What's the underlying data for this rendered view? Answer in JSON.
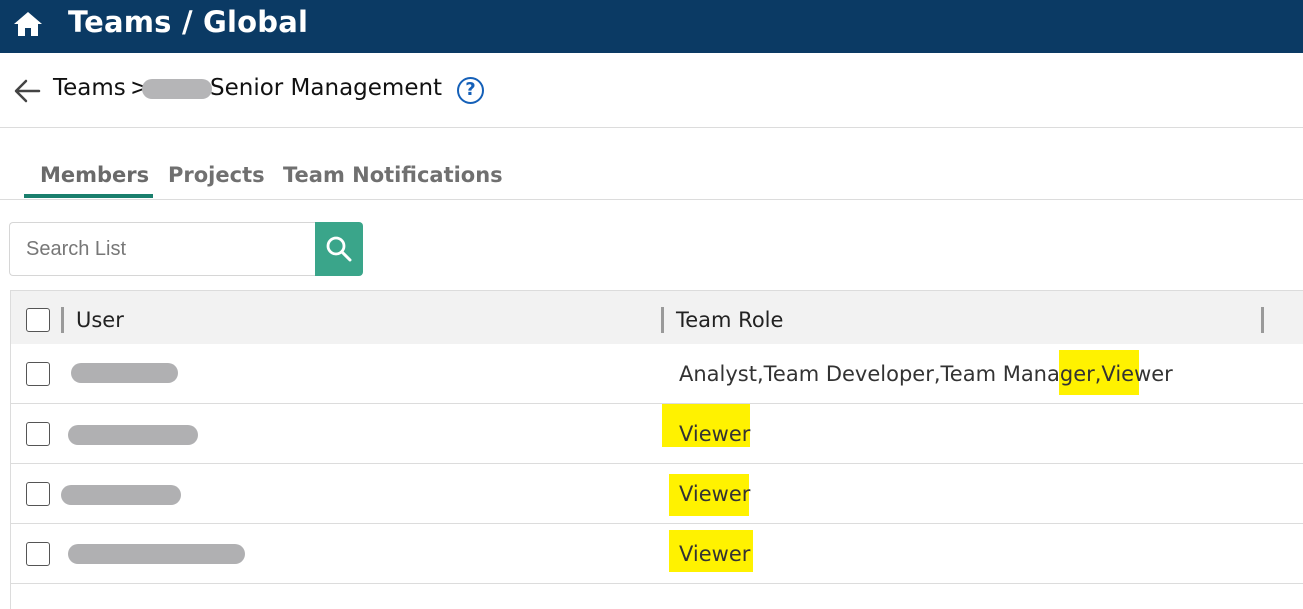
{
  "topbar": {
    "title": "Teams / Global",
    "icon": "home-icon"
  },
  "breadcrumb": {
    "teams": "Teams",
    "separator": ">",
    "current": "Senior Management",
    "help": "?"
  },
  "tabs": [
    {
      "label": "Members",
      "active": true
    },
    {
      "label": "Projects",
      "active": false
    },
    {
      "label": "Team Notifications",
      "active": false
    }
  ],
  "search": {
    "placeholder": "Search List"
  },
  "table": {
    "headers": {
      "user": "User",
      "team_role": "Team Role"
    },
    "rows": [
      {
        "role_prefix": "Analyst,Team Developer,Team Manager,",
        "role_highlight": "Viewer"
      },
      {
        "role_prefix": "",
        "role_highlight": "Viewer"
      },
      {
        "role_prefix": "",
        "role_highlight": "Viewer"
      },
      {
        "role_prefix": "",
        "role_highlight": "Viewer"
      }
    ]
  },
  "colors": {
    "topbar": "#0b3a64",
    "accent": "#1a7f6d",
    "search_button": "#3aa58a",
    "highlight": "#fff200",
    "help": "#1560b8"
  }
}
